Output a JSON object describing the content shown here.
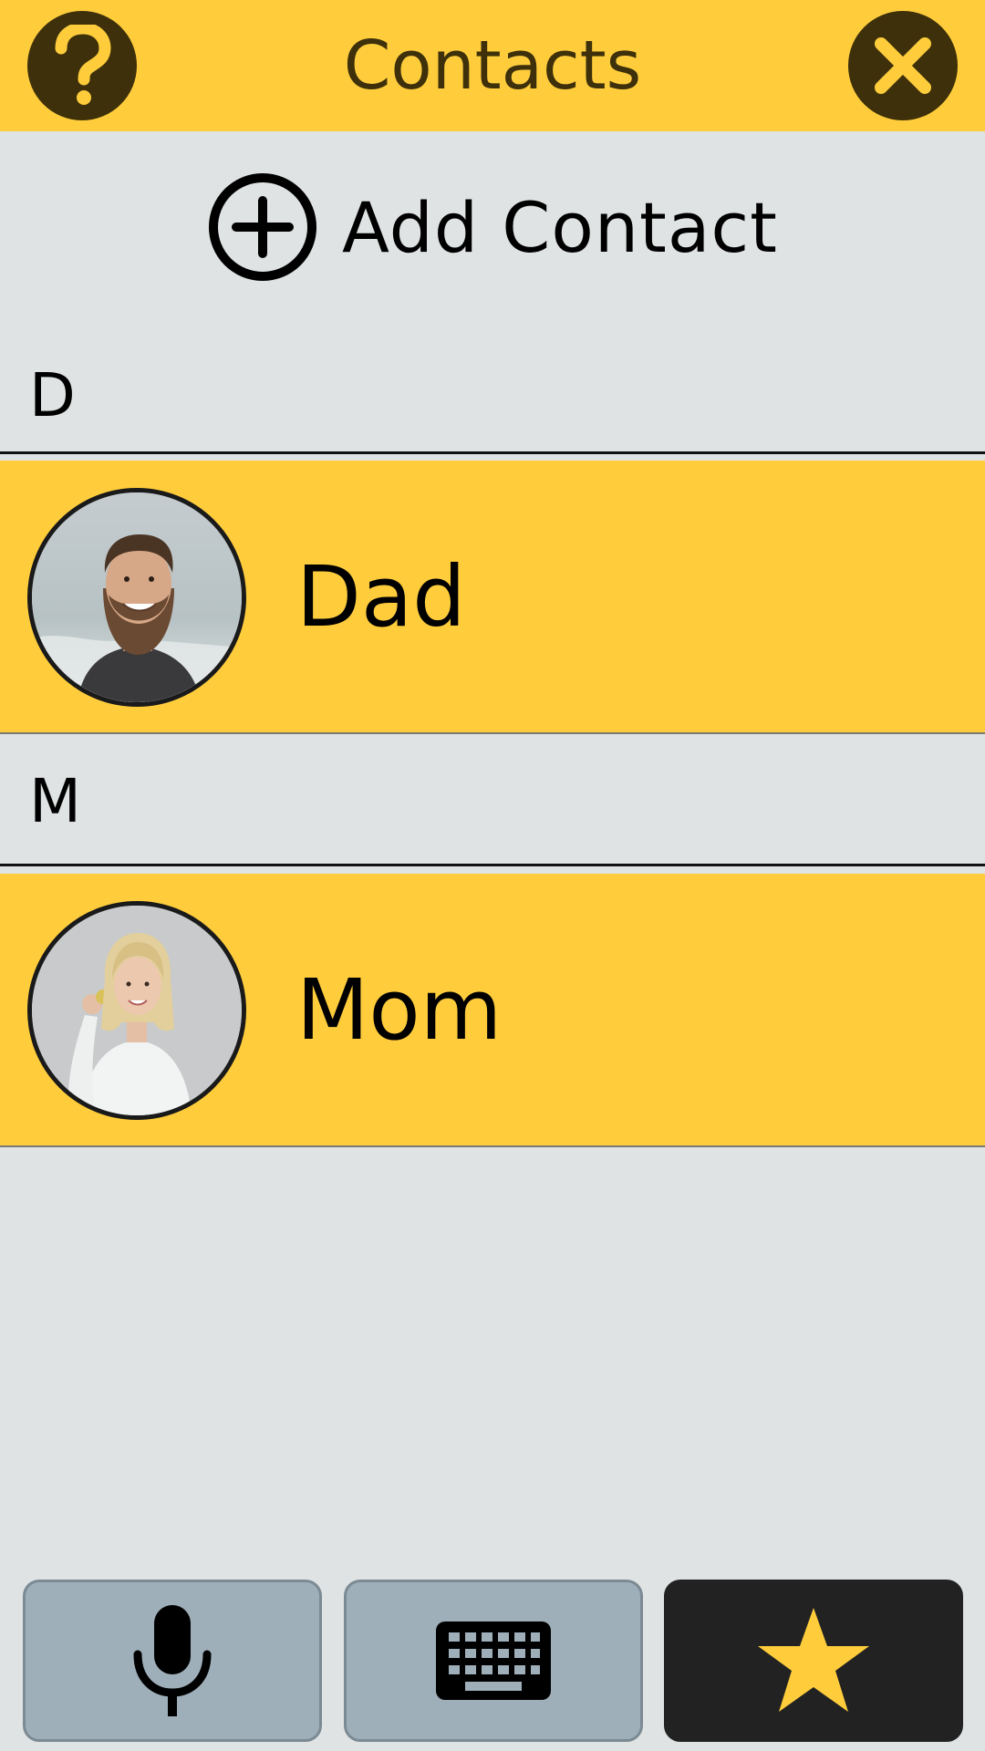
{
  "header": {
    "title": "Contacts",
    "help_icon": "question-mark-icon",
    "close_icon": "close-x-icon"
  },
  "add_contact": {
    "label": "Add Contact",
    "icon": "plus-circle-icon"
  },
  "sections": [
    {
      "letter": "D",
      "contacts": [
        {
          "name": "Dad",
          "avatar": "bearded-man-photo"
        }
      ]
    },
    {
      "letter": "M",
      "contacts": [
        {
          "name": "Mom",
          "avatar": "blonde-woman-photo"
        }
      ]
    }
  ],
  "bottom_bar": {
    "buttons": [
      {
        "icon": "microphone-icon",
        "active": false
      },
      {
        "icon": "keyboard-icon",
        "active": false
      },
      {
        "icon": "star-icon",
        "active": true
      }
    ]
  },
  "colors": {
    "accent_yellow": "#ffcd3c",
    "header_dark": "#3d300a",
    "background": "#dfe3e4",
    "button_gray": "#9eafba",
    "button_active": "#222222"
  }
}
